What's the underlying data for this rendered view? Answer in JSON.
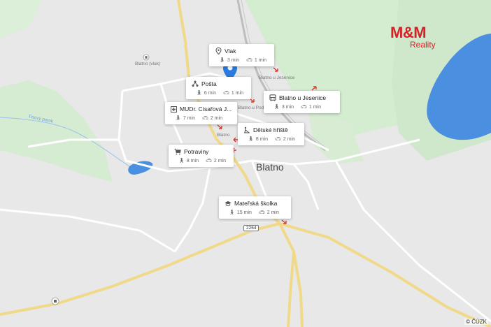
{
  "map": {
    "town_name": "Blatno",
    "stop_label_1": "Blatno (vlak)",
    "stop_label_2": "Blatno u Jesenice",
    "stop_label_3": "Blatno u Podb.",
    "village_label": "Blatno",
    "stream_label": "Tisový potok",
    "road_number": "2264",
    "copyright": "© ČÚZK",
    "colors": {
      "background": "#e8e8e8",
      "green": "#d4ecd0",
      "water": "#4a90e2",
      "road_major": "#f6e39a",
      "pin": "#2a7be0",
      "logo": "#d71f26"
    }
  },
  "logo": {
    "main": "M&M",
    "sub": "Reality"
  },
  "pois": [
    {
      "key": "vlak",
      "name": "Vlak",
      "icon": "location-pin-icon",
      "walk": "3 min",
      "car": "1 min"
    },
    {
      "key": "posta",
      "name": "Pošta",
      "icon": "post-office-icon",
      "walk": "6 min",
      "car": "1 min"
    },
    {
      "key": "lekar",
      "name": "MUDr. Císařová J...",
      "icon": "medical-cross-icon",
      "walk": "7 min",
      "car": "2 min"
    },
    {
      "key": "bus",
      "name": "Blatno u Jesenice",
      "icon": "bus-icon",
      "walk": "3 min",
      "car": "1 min"
    },
    {
      "key": "hriste",
      "name": "Dětské hřiště",
      "icon": "playground-icon",
      "walk": "8 min",
      "car": "2 min"
    },
    {
      "key": "potraviny",
      "name": "Potraviny",
      "icon": "shopping-cart-icon",
      "walk": "8 min",
      "car": "2 min"
    },
    {
      "key": "skolka",
      "name": "Mateřská školka",
      "icon": "school-icon",
      "walk": "15 min",
      "car": "2 min"
    }
  ]
}
